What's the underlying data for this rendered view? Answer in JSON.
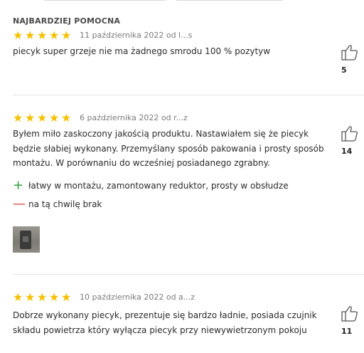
{
  "section_label": "NAJBARDZIEJ POMOCNA",
  "colors": {
    "star": "#f5c000",
    "plus": "#2e9e3a",
    "minus": "#d94040"
  },
  "reviews": [
    {
      "rating": 5,
      "meta": "11 października 2022 od l...s",
      "text": "piecyk super grzeje nie ma żadnego smrodu 100 % pozytyw",
      "likes": "5"
    },
    {
      "rating": 5,
      "meta": "6 października 2022 od r...z",
      "text": "Byłem miło zaskoczony jakością produktu. Nastawiałem się że piecyk będzie słabiej wykonany. Przemyślany sposób pakowania i prosty sposób montażu. W porównaniu do wcześniej posiadanego zgrabny.",
      "pros_sign": "+",
      "pros": "łatwy w montażu, zamontowany reduktor, prosty w obsłudze",
      "cons_sign": "—",
      "cons": "na tą chwilę brak",
      "photo_icon": "stove-photo",
      "likes": "14"
    },
    {
      "rating": 5,
      "meta": "10 października 2022 od a...z",
      "text": "Dobrze wykonany piecyk, prezentuje się bardzo ładnie, posiada czujnik składu powietrza który wyłącza piecyk przy niewywietrzonym pokoju",
      "likes": "11"
    }
  ]
}
